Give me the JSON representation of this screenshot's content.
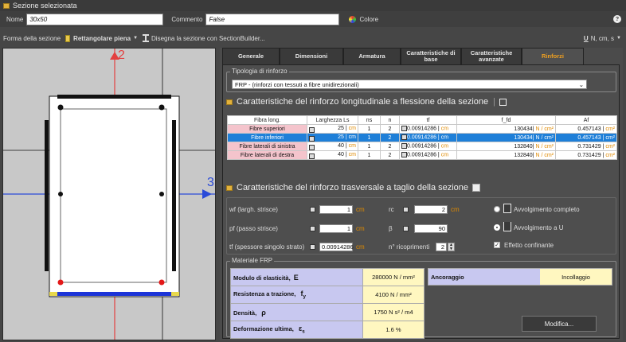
{
  "window": {
    "title": "Sezione selezionata"
  },
  "toolbar": {
    "name_label": "Nome",
    "name_value": "30x50",
    "comment_label": "Commento",
    "comment_value": "False",
    "color_label": "Colore",
    "help": "?"
  },
  "section_bar": {
    "shape_label": "Forma della sezione",
    "shape_value": "Rettangolare piena",
    "builder_label": "Disegna la sezione con SectionBuilder...",
    "units": "N, cm, s"
  },
  "axes": {
    "a2": "2",
    "a3": "3"
  },
  "tabs": [
    "Generale",
    "Dimensioni",
    "Armatura",
    "Caratteristiche di base",
    "Caratteristiche avanzate",
    "Rinforzi"
  ],
  "typology": {
    "legend": "Tipologia di rinforzo",
    "value": "FRP - (rinforzi con tessuti a fibre unidirezionali)"
  },
  "longitudinal": {
    "title": "Caratteristiche del rinforzo longitudinale a flessione della sezione",
    "headers": [
      "Fibra long.",
      "Larghezza Ls",
      "ns",
      "n",
      "tf",
      "f_fd",
      "Af"
    ],
    "rows": [
      {
        "name": "Fibre superiori",
        "ls": "25",
        "ls_unit": "cm",
        "ns": "1",
        "n": "2",
        "tf": "0.00914286",
        "tf_unit": "cm",
        "ffd": "130434",
        "ffd_unit": "N / cm²",
        "af": "0.457143",
        "af_unit": "cm²"
      },
      {
        "name": "Fibre inferiori",
        "ls": "25",
        "ls_unit": "cm",
        "ns": "1",
        "n": "2",
        "tf": "0.00914286",
        "tf_unit": "cm",
        "ffd": "130434",
        "ffd_unit": "N / cm²",
        "af": "0.457143",
        "af_unit": "cm²"
      },
      {
        "name": "Fibre laterali di sinistra",
        "ls": "40",
        "ls_unit": "cm",
        "ns": "1",
        "n": "2",
        "tf": "0.00914286",
        "tf_unit": "cm",
        "ffd": "132840",
        "ffd_unit": "N / cm²",
        "af": "0.731429",
        "af_unit": "cm²"
      },
      {
        "name": "Fibre laterali di destra",
        "ls": "40",
        "ls_unit": "cm",
        "ns": "1",
        "n": "2",
        "tf": "0.00914286",
        "tf_unit": "cm",
        "ffd": "132840",
        "ffd_unit": "N / cm²",
        "af": "0.731429",
        "af_unit": "cm²"
      }
    ]
  },
  "transverse": {
    "title": "Caratteristiche del rinforzo trasversale a taglio della sezione",
    "wf_label": "wf (largh. strisce)",
    "wf_value": "1",
    "wf_unit": "cm",
    "pf_label": "pf (passo strisce)",
    "pf_value": "1",
    "pf_unit": "cm",
    "tf_label": "tf (spessore singolo strato)",
    "tf_value": "0.00914286",
    "tf_unit": "cm",
    "rc_label": "rc",
    "rc_value": "2",
    "rc_unit": "cm",
    "beta_label": "β",
    "beta_value": "90",
    "nric_label": "n° ricoprimenti",
    "nric_value": "2",
    "opt1": "Avvolgimento completo",
    "opt2": "Avvolgimento a U",
    "confine": "Effetto confinante"
  },
  "material": {
    "legend": "Materiale FRP",
    "rows": [
      {
        "label": "Modulo di elasticità,",
        "sym": "E",
        "value": "280000 N / mm²"
      },
      {
        "label": "Resistenza a trazione,",
        "sym": "f",
        "sub": "y",
        "value": "4100 N / mm²"
      },
      {
        "label": "Densità,",
        "sym": "ρ",
        "value": "1750 N s² / m4"
      },
      {
        "label": "Deformazione ultima,",
        "sym": "ε",
        "sub": "s",
        "value": "1.6 %"
      }
    ],
    "anchor_label": "Ancoraggio",
    "anchor_value": "Incollaggio",
    "modify": "Modifica..."
  }
}
